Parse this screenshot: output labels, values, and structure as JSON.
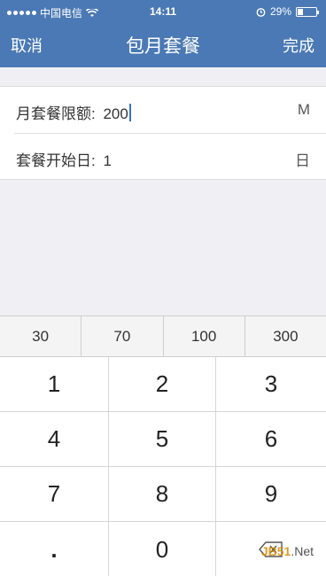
{
  "status_bar": {
    "carrier": "中国电信",
    "time": "14:11",
    "battery_percent": "29%",
    "battery_level": 0.29
  },
  "nav": {
    "cancel_label": "取消",
    "title": "包月套餐",
    "done_label": "完成"
  },
  "form": {
    "limit": {
      "label": "月套餐限额:",
      "value": "200",
      "unit": "M"
    },
    "start_day": {
      "label": "套餐开始日:",
      "value": "1",
      "unit": "日"
    }
  },
  "keyboard": {
    "quick_values": [
      "30",
      "70",
      "100",
      "300"
    ],
    "keys": [
      "1",
      "2",
      "3",
      "4",
      "5",
      "6",
      "7",
      "8",
      "9",
      ".",
      "0"
    ]
  },
  "watermark": {
    "jb": "JB51",
    "net": ".Net"
  },
  "colors": {
    "nav_bg": "#4a79b5",
    "caret": "#3b6fd8",
    "background": "#efeff4"
  }
}
